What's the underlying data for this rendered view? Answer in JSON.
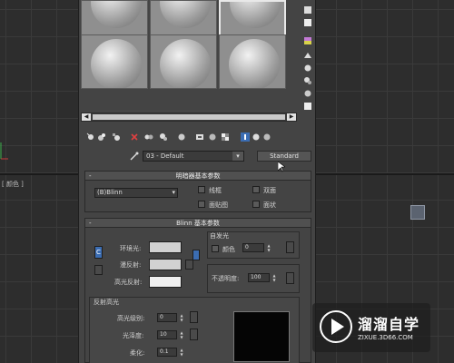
{
  "viewport": {
    "label": "[ 颜色 ]"
  },
  "material_editor": {
    "material_name": "03 - Default",
    "material_type_button": "Standard",
    "shader_basic_params": {
      "title": "明暗器基本参数",
      "shader_value": "(B)Blinn",
      "wire_label": "线框",
      "two_sided_label": "双面",
      "face_map_label": "面贴图",
      "faceted_label": "面状"
    },
    "blinn_basic_params": {
      "title": "Blinn 基本参数",
      "self_illum_group": "自发光",
      "self_illum_color_label": "颜色",
      "self_illum_value": "0",
      "ambient_label": "环境光:",
      "diffuse_label": "漫反射:",
      "specular_label": "高光反射:",
      "opacity_label": "不透明度:",
      "opacity_value": "100",
      "lock_label": "C"
    },
    "specular_highlights": {
      "title": "反射高光",
      "level_label": "高光级别:",
      "level_value": "0",
      "glossiness_label": "光泽度:",
      "glossiness_value": "10",
      "soften_label": "柔化:",
      "soften_value": "0.1"
    }
  },
  "watermark": {
    "title": "溜溜自学",
    "subtitle": "ZIXUE.3D66.COM"
  }
}
